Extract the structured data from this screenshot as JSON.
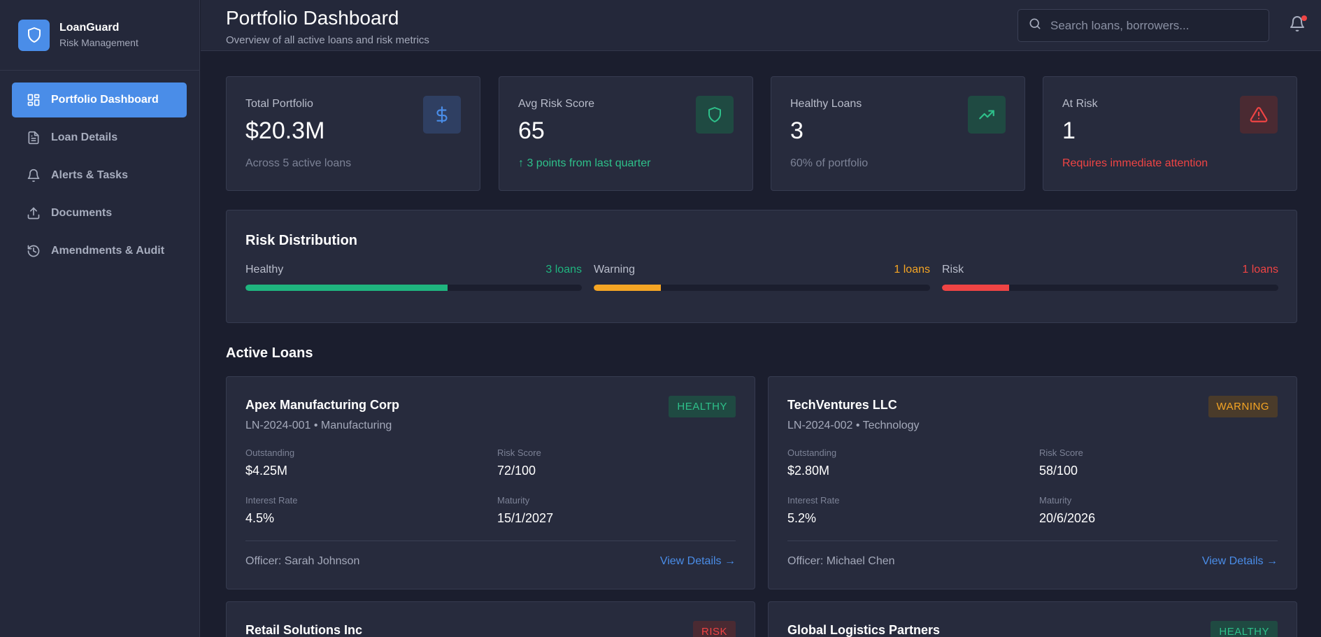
{
  "brand": {
    "name": "LoanGuard",
    "subtitle": "Risk Management"
  },
  "nav": [
    {
      "label": "Portfolio Dashboard",
      "icon": "grid-icon",
      "active": true
    },
    {
      "label": "Loan Details",
      "icon": "document-icon"
    },
    {
      "label": "Alerts & Tasks",
      "icon": "bell-icon"
    },
    {
      "label": "Documents",
      "icon": "upload-icon"
    },
    {
      "label": "Amendments & Audit",
      "icon": "history-icon"
    }
  ],
  "header": {
    "title": "Portfolio Dashboard",
    "subtitle": "Overview of all active loans and risk metrics",
    "search_placeholder": "Search loans, borrowers..."
  },
  "stats": [
    {
      "label": "Total Portfolio",
      "value": "$20.3M",
      "note": "Across 5 active loans",
      "icon": "dollar-icon",
      "color": "#4a8de8"
    },
    {
      "label": "Avg Risk Score",
      "value": "65",
      "note": "↑ 3 points from last quarter",
      "icon": "shield-icon",
      "color": "#2ec08a"
    },
    {
      "label": "Healthy Loans",
      "value": "3",
      "note": "60% of portfolio",
      "icon": "trending-up-icon",
      "color": "#2ec08a"
    },
    {
      "label": "At Risk",
      "value": "1",
      "note": "Requires immediate attention",
      "icon": "alert-triangle-icon",
      "color": "#ef4444"
    }
  ],
  "risk_distribution": {
    "title": "Risk Distribution",
    "items": [
      {
        "name": "Healthy",
        "count": "3 loans",
        "fraction": 0.6,
        "color": "#1fb57f"
      },
      {
        "name": "Warning",
        "count": "1 loans",
        "fraction": 0.2,
        "color": "#f5a524"
      },
      {
        "name": "Risk",
        "count": "1 loans",
        "fraction": 0.2,
        "color": "#ef4444"
      }
    ]
  },
  "active_loans": {
    "title": "Active Loans",
    "labels": {
      "outstanding": "Outstanding",
      "risk_score": "Risk Score",
      "interest_rate": "Interest Rate",
      "maturity": "Maturity",
      "view": "View Details →"
    },
    "loans": [
      {
        "name": "Apex Manufacturing Corp",
        "meta": "LN-2024-001 • Manufacturing",
        "status": "HEALTHY",
        "outstanding": "$4.25M",
        "risk_score": "72/100",
        "interest_rate": "4.5%",
        "maturity": "15/1/2027",
        "officer": "Officer: Sarah Johnson"
      },
      {
        "name": "TechVentures LLC",
        "meta": "LN-2024-002 • Technology",
        "status": "WARNING",
        "outstanding": "$2.80M",
        "risk_score": "58/100",
        "interest_rate": "5.2%",
        "maturity": "20/6/2026",
        "officer": "Officer: Michael Chen"
      },
      {
        "name": "Retail Solutions Inc",
        "status": "RISK"
      },
      {
        "name": "Global Logistics Partners",
        "status": "HEALTHY"
      }
    ]
  }
}
